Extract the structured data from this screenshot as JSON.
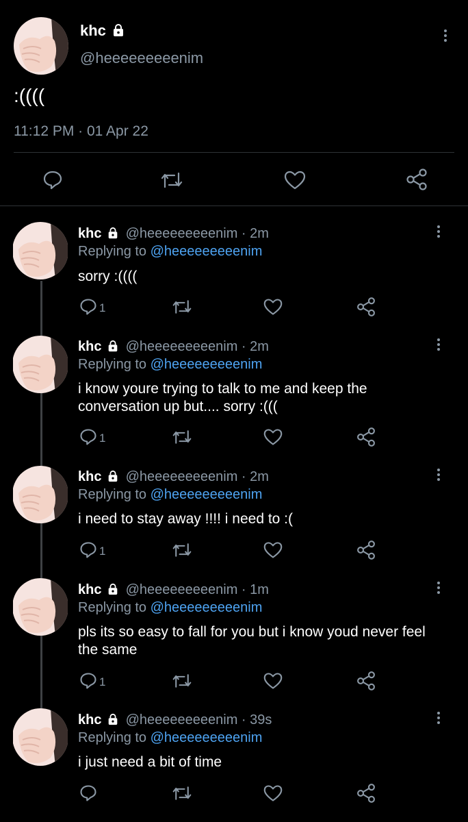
{
  "main_tweet": {
    "name": "khc",
    "handle": "@heeeeeeeeenim",
    "text": ":((((",
    "meta": "11:12 PM · 01 Apr 22"
  },
  "replies": [
    {
      "name": "khc",
      "handle": "@heeeeeeeeenim",
      "time": "· 2m",
      "replying_label": "Replying to",
      "replying_to": "@heeeeeeeeenim",
      "text": "sorry :((((",
      "reply_count": "1"
    },
    {
      "name": "khc",
      "handle": "@heeeeeeeeenim",
      "time": "· 2m",
      "replying_label": "Replying to",
      "replying_to": "@heeeeeeeeenim",
      "text": "i know youre trying to talk to me and keep the conversation up but.... sorry :(((",
      "reply_count": "1"
    },
    {
      "name": "khc",
      "handle": "@heeeeeeeeenim",
      "time": "· 2m",
      "replying_label": "Replying to",
      "replying_to": "@heeeeeeeeenim",
      "text": "i need to stay away !!!! i need to :(",
      "reply_count": "1"
    },
    {
      "name": "khc",
      "handle": "@heeeeeeeeenim",
      "time": "· 1m",
      "replying_label": "Replying to",
      "replying_to": "@heeeeeeeeenim",
      "text": "pls its so easy to fall for you but i know youd never feel the same",
      "reply_count": "1"
    },
    {
      "name": "khc",
      "handle": "@heeeeeeeeenim",
      "time": "· 39s",
      "replying_label": "Replying to",
      "replying_to": "@heeeeeeeeenim",
      "text": "i just need a bit of time",
      "reply_count": ""
    }
  ],
  "icons": {
    "lock": "lock-icon",
    "reply": "reply-icon",
    "retweet": "retweet-icon",
    "like": "heart-icon",
    "share": "share-icon",
    "more": "more-icon"
  },
  "colors": {
    "background": "#000000",
    "text": "#e7e9ea",
    "muted": "#8b98a5",
    "link": "#4ea3f1",
    "divider": "#2f3336"
  }
}
